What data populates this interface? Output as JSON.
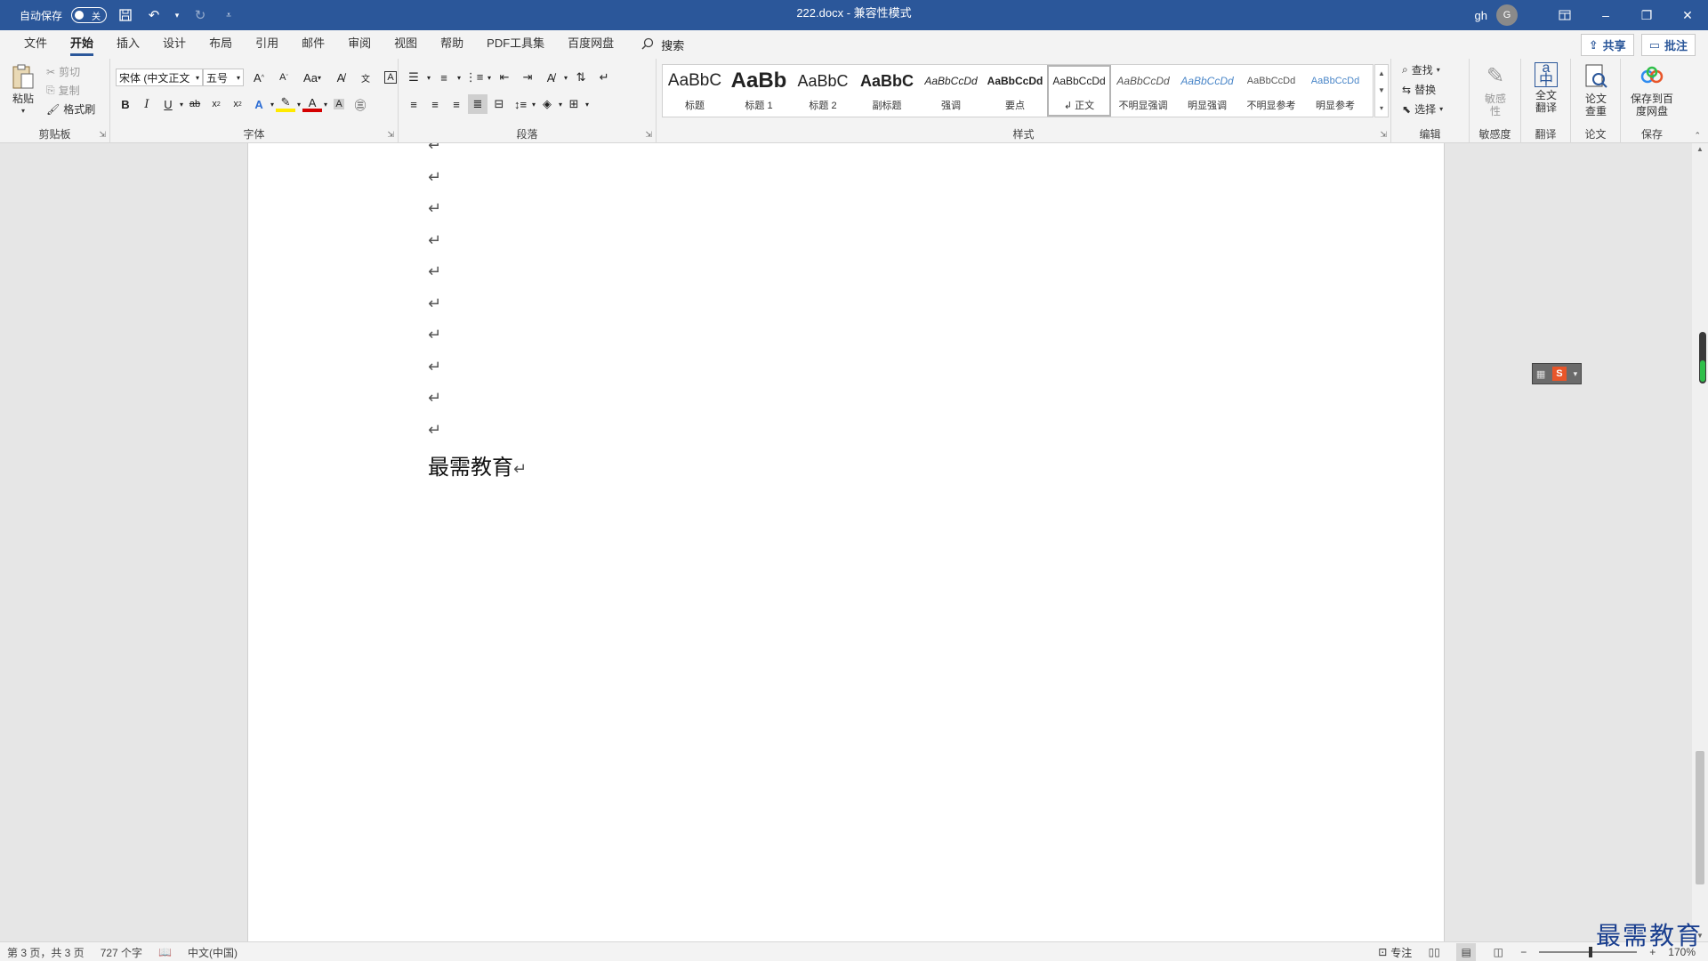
{
  "titlebar": {
    "autosave_label": "自动保存",
    "autosave_state": "关",
    "document_title": "222.docx  -  兼容性模式",
    "user_name": "gh",
    "user_initial": "G"
  },
  "tabs": [
    "文件",
    "开始",
    "插入",
    "设计",
    "布局",
    "引用",
    "邮件",
    "审阅",
    "视图",
    "帮助",
    "PDF工具集",
    "百度网盘"
  ],
  "active_tab": "开始",
  "search_label": "搜索",
  "share_label": "共享",
  "comments_label": "批注",
  "clipboard": {
    "paste_label": "粘贴",
    "cut_label": "剪切",
    "copy_label": "复制",
    "format_painter_label": "格式刷",
    "group_label": "剪贴板"
  },
  "font": {
    "font_name": "宋体 (中文正文",
    "font_size": "五号",
    "group_label": "字体",
    "change_case": "Aa"
  },
  "paragraph": {
    "group_label": "段落"
  },
  "styles": {
    "group_label": "样式",
    "items": [
      {
        "sample": "AaBbC",
        "name": "标题"
      },
      {
        "sample": "AaBb",
        "name": "标题 1"
      },
      {
        "sample": "AaBbC",
        "name": "标题 2"
      },
      {
        "sample": "AaBbC",
        "name": "副标题"
      },
      {
        "sample": "AaBbCcDd",
        "name": "强调"
      },
      {
        "sample": "AaBbCcDd",
        "name": "要点"
      },
      {
        "sample": "AaBbCcDd",
        "name": "正文"
      },
      {
        "sample": "AaBbCcDd",
        "name": "不明显强调"
      },
      {
        "sample": "AaBbCcDd",
        "name": "明显强调"
      },
      {
        "sample": "AaBbCcDd",
        "name": "不明显参考"
      },
      {
        "sample": "AaBbCcDd",
        "name": "明显参考"
      }
    ],
    "active_name": "正文"
  },
  "editing": {
    "find_label": "查找",
    "replace_label": "替换",
    "select_label": "选择",
    "group_label": "编辑"
  },
  "sensitivity": {
    "button_label": "敏感性",
    "group_label": "敏感度"
  },
  "translate": {
    "button_label": "全文翻译",
    "group_label": "翻译"
  },
  "paper": {
    "button_label": "论文查重",
    "group_label": "论文"
  },
  "save": {
    "button_label": "保存到百度网盘",
    "group_label": "保存"
  },
  "document": {
    "empty_paragraph_count": 10,
    "paragraph_mark": "↵",
    "text_line": "最需教育"
  },
  "statusbar": {
    "page_info": "第 3 页，共 3 页",
    "word_count": "727 个字",
    "language": "中文(中国)",
    "focus_label": "专注",
    "zoom_level": "170%"
  },
  "watermark": "最需教育"
}
